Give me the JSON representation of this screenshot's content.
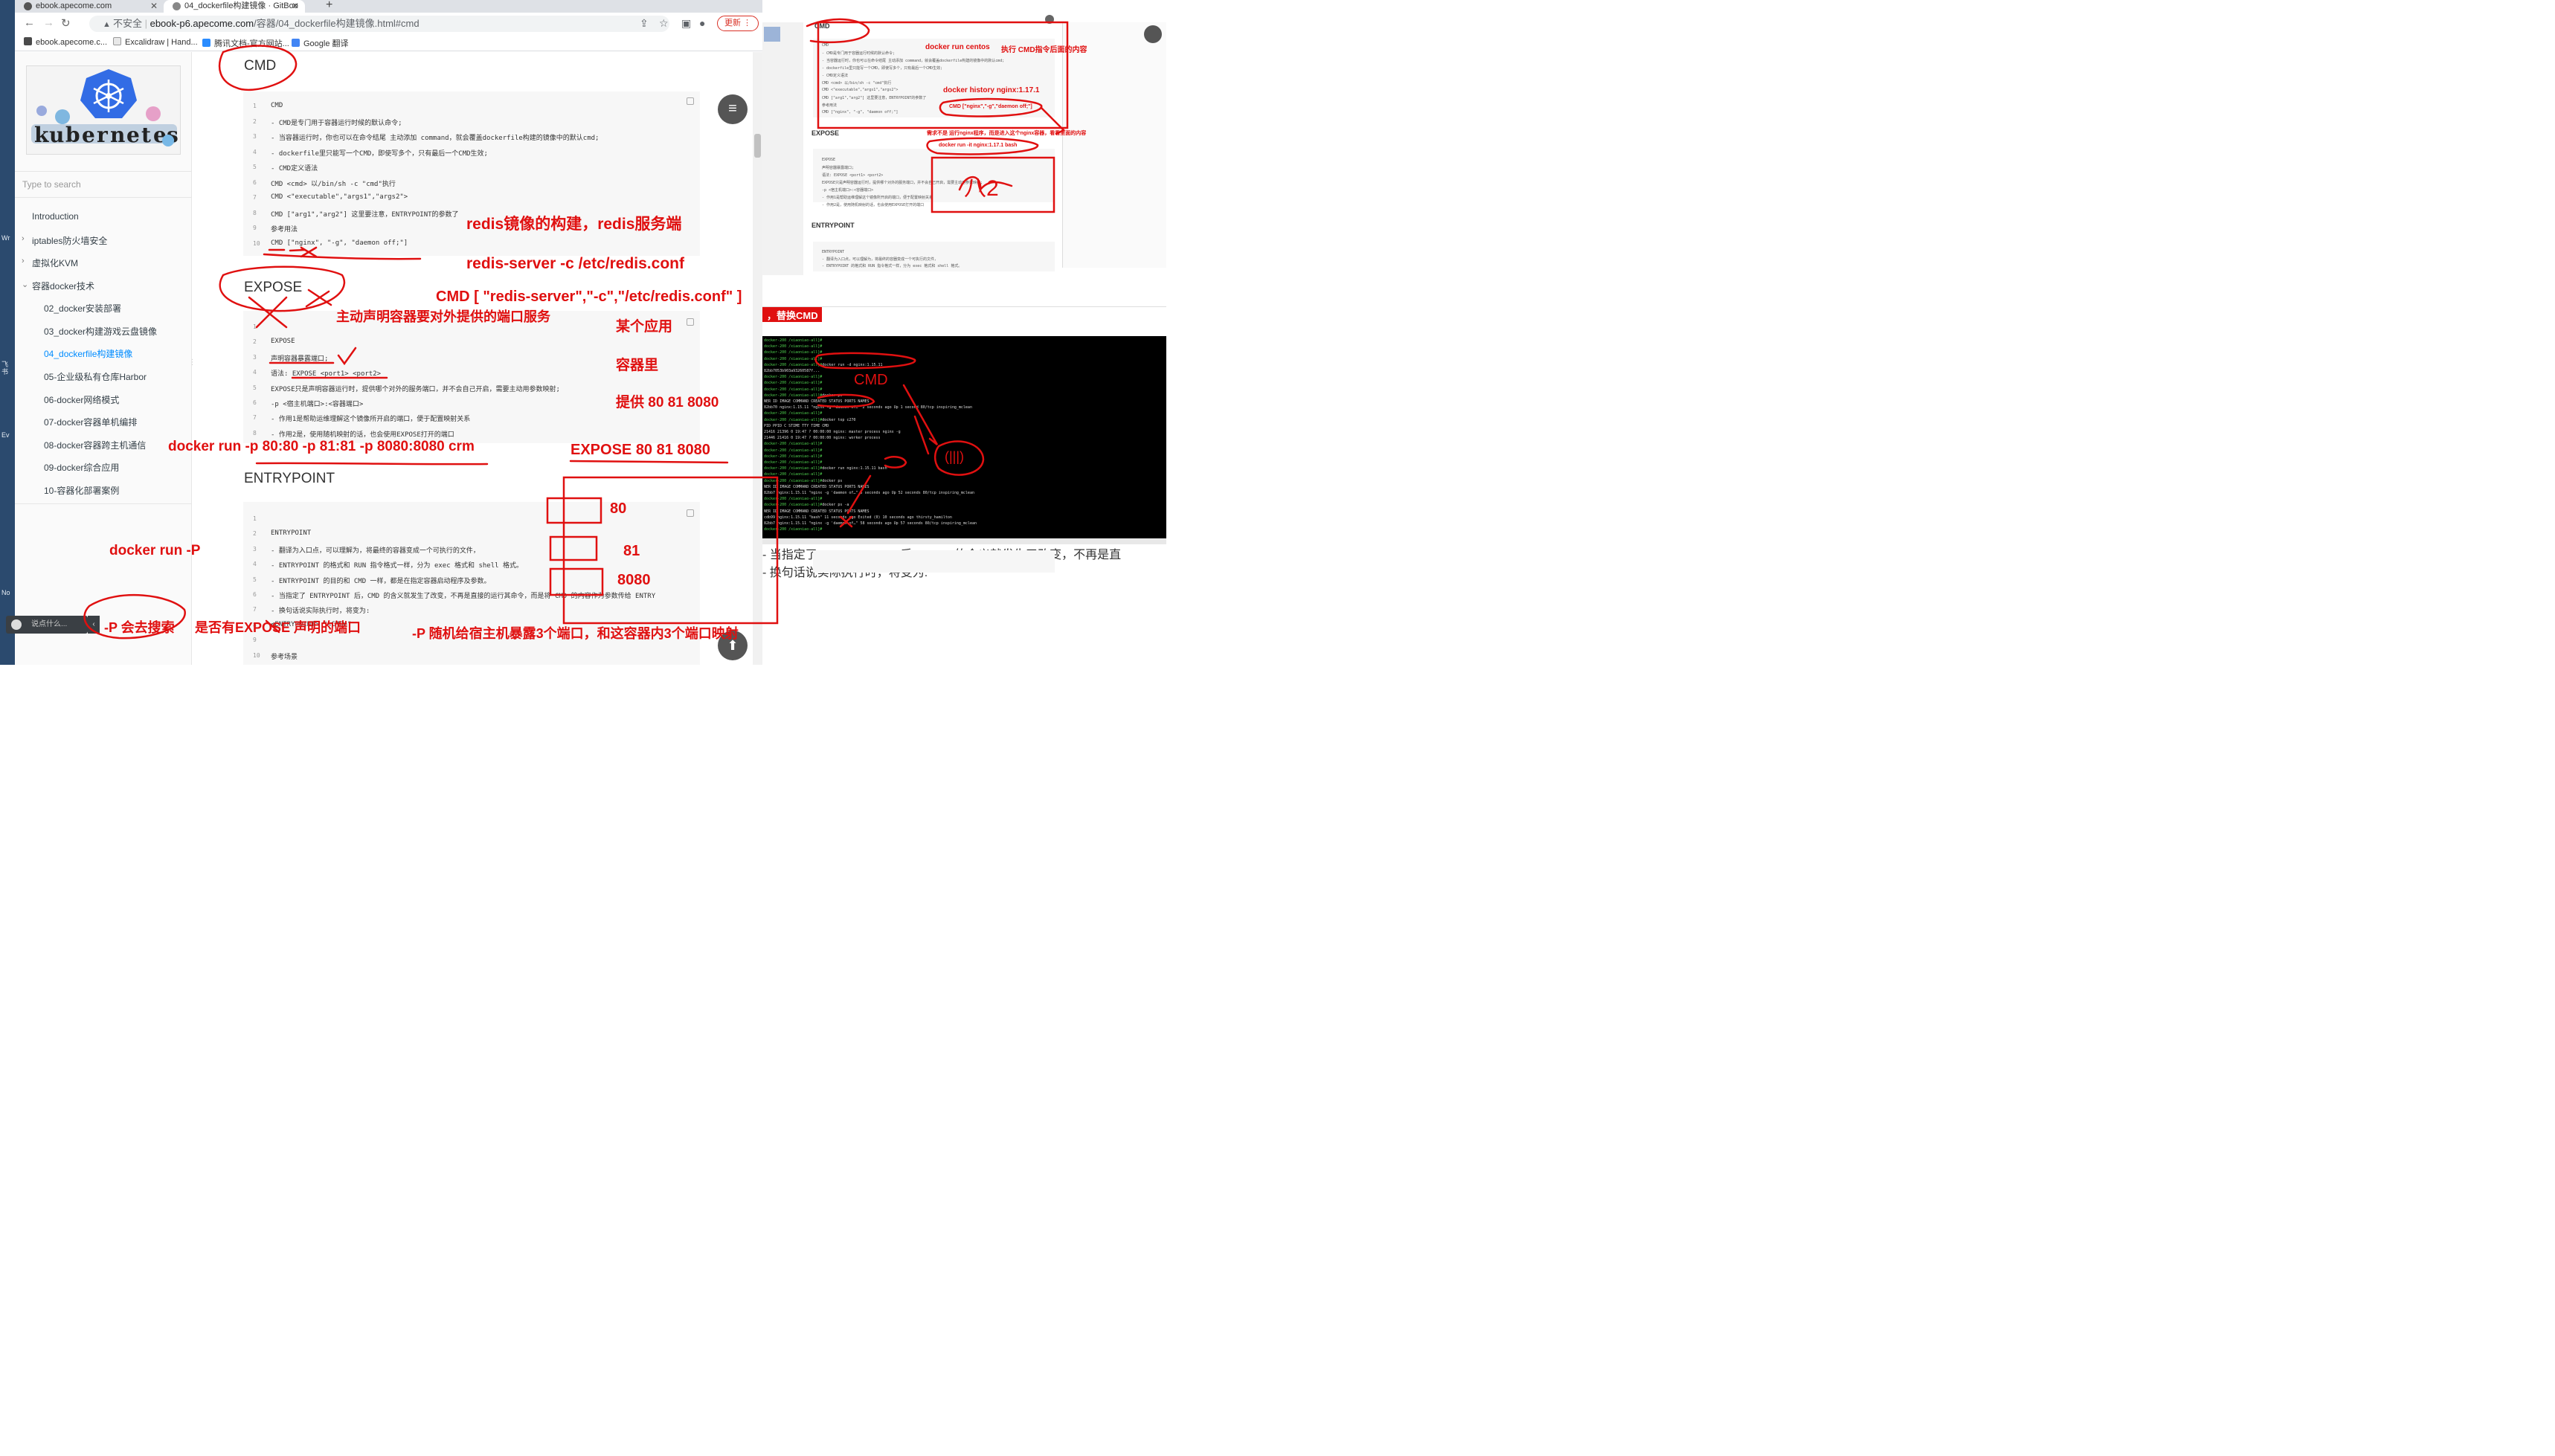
{
  "desktop": {
    "labels": [
      "Wr",
      "飞书",
      "Ev",
      "No"
    ]
  },
  "browser": {
    "tabs": [
      {
        "title": "ebook.apecome.com"
      },
      {
        "title": "04_dockerfile构建镜像 · GitBoo"
      }
    ],
    "new_tab": "+",
    "url_warning": "不安全",
    "url_domain": "ebook-p6.apecome.com",
    "url_path": "/容器/04_dockerfile构建镜像.html#cmd",
    "update_label": "更新",
    "bookmarks": [
      "ebook.apecome.c...",
      "Excalidraw | Hand...",
      "腾讯文档-官方网站...",
      "Google 翻译"
    ]
  },
  "sidebar": {
    "search_placeholder": "Type to search",
    "items": [
      {
        "label": "Introduction"
      },
      {
        "label": "iptables防火墙安全"
      },
      {
        "label": "虚拟化KVM"
      },
      {
        "label": "容器docker技术"
      },
      {
        "label": "02_docker安装部署"
      },
      {
        "label": "03_docker构建游戏云盘镜像"
      },
      {
        "label": "04_dockerfile构建镜像"
      },
      {
        "label": "05-企业级私有仓库Harbor"
      },
      {
        "label": "06-docker网络模式"
      },
      {
        "label": "07-docker容器单机编排"
      },
      {
        "label": "08-docker容器跨主机通信"
      },
      {
        "label": "09-docker综合应用"
      },
      {
        "label": "10-容器化部署案例"
      }
    ],
    "chat_placeholder": "说点什么..."
  },
  "content": {
    "h_cmd": "CMD",
    "cmd_lines": [
      "CMD",
      "- CMD是专门用于容器运行时候的默认命令;",
      "- 当容器运行时，你也可以在命令结尾 主动添加 command，就会覆盖dockerfile构建的镜像中的默认cmd;",
      "- dockerfile里只能写一个CMD，即使写多个，只有最后一个CMD生效;",
      "- CMD定义语法",
      "CMD <cmd>  以/bin/sh -c \"cmd\"执行",
      "CMD <\"executable\",\"args1\",\"args2\">",
      "CMD [\"arg1\",\"arg2\"]    这里要注意，ENTRYPOINT的参数了",
      "参考用法",
      "CMD [\"nginx\", \"-g\", \"daemon off;\"]"
    ],
    "h_expose": "EXPOSE",
    "expose_lines": [
      "",
      "EXPOSE",
      "声明容器暴露端口;",
      "语法: EXPOSE <port1> <port2>",
      "EXPOSE只是声明容器运行时，提供哪个对外的服务端口，并不会自己开启，需要主动用参数映射;",
      "-p <宿主机端口>:<容器端口>",
      "- 作用1是帮助运维理解这个镜像所开启的端口，便于配置映射关系",
      "- 作用2是，使用随机映射的话，也会使用EXPOSE打开的端口"
    ],
    "h_entrypoint": "ENTRYPOINT",
    "entry_lines": [
      "",
      "ENTRYPOINT",
      "- 翻译为入口点，可以理解为，将最终的容器变成一个可执行的文件，",
      "- ENTRYPOINT 的格式和 RUN 指令格式一样，分为 exec 格式和 shell 格式。",
      "- ENTRYPOINT 的目的和 CMD 一样，都是在指定容器启动程序及参数。",
      "- 当指定了 ENTRYPOINT 后，CMD 的含义就发生了改变，不再是直接的运行其命令，而是将 CMD 的内容作为参数传给 ENTRY",
      "- 换句话说实际执行时，将变为:",
      "<ENTRYPOINT> \"<CMD>\"",
      "",
      "参考场景"
    ],
    "menu_icon": "≡",
    "up_icon": "⬆"
  },
  "right_panel": {
    "h_cmd": "CMD",
    "h_expose": "EXPOSE",
    "h_entrypoint": "ENTRYPOINT",
    "replace_cmd": "，替换CMD",
    "mini_cmd": [
      "CMD",
      "- CMD是专门用于容器运行时候的默认命令;",
      "- 当容器运行时，你也可以在命令结尾 主动添加 command，就会覆盖dockerfile构建的镜像中的默认cmd;",
      "- dockerfile里只能写一个CMD，即使写多个，只有最后一个CMD生效;",
      "- CMD定义语法",
      "CMD <cmd>  以/bin/sh -c \"cmd\"执行",
      "CMD <\"executable\",\"args1\",\"args2\">",
      "CMD [\"arg1\",\"arg2\"]   这里要注意，ENTRYPOINT的参数了",
      "参考用法",
      "CMD [\"nginx\", \"-g\", \"daemon off;\"]"
    ],
    "mini_expose": [
      "EXPOSE",
      "声明容器暴露端口;",
      "语法: EXPOSE <port1> <port2>",
      "EXPOSE只是声明容器运行时，提供哪个对外的服务端口，并不会自己开启，需要主动用参数映射;",
      "-p <宿主机端口>:<容器端口>",
      "- 作用1是帮助运维理解这个镜像所开启的端口，便于配置映射关系",
      "- 作用2是，使用随机映射的话，也会使用EXPOSE打开的端口"
    ],
    "mini_entry": [
      "ENTRYPOINT",
      "- 翻译为入口点，可以理解为，将最终的容器变成一个可执行的文件，",
      "- ENTRYPOINT 的格式和 RUN 指令格式一样，分为 exec 格式和 shell 格式。"
    ],
    "mini_bottom": [
      "- 当指定了 ENTRYPOINT 后，CMD 的含义就发生了改变，不再是直",
      "- 换句话说实际执行时，将变为:"
    ],
    "terminal_lines": [
      "docker-200 /xiaoniao-all]#",
      "docker-200 /xiaoniao-all]#",
      "docker-200 /xiaoniao-all]#",
      "docker-200 /xiaoniao-all]#",
      "docker-200 /xiaoniao-all]#docker run -d  nginx:1.15.11",
      "82bb7053b903a93260587f...",
      "docker-200 /xiaoniao-all]#",
      "docker-200 /xiaoniao-all]#",
      "docker-200 /xiaoniao-all]#",
      "docker-200 /xiaoniao-all]#docker ps",
      "NER ID   IMAGE          COMMAND                  CREATED          STATUS          PORTS    NAMES",
      "82bb70   nginx:1.15.11  \"nginx -g 'daemon of…\"  2 seconds ago    Up 1 second     80/tcp   inspiring_mclean",
      "docker-200 /xiaoniao-all]#",
      "docker-200 /xiaoniao-all]#docker  top c270",
      "          PID        PPID       C       STIME     TTY       TIME       CMD",
      "          21416      21396      0       19:47     ?         00:00:00   nginx: master process nginx -g",
      "          21446      21416      0       19:47     ?         00:00:00   nginx: worker process",
      "docker-200 /xiaoniao-all]#",
      "docker-200 /xiaoniao-all]#",
      "docker-200 /xiaoniao-all]#",
      "docker-200 /xiaoniao-all]#",
      "docker-200 /xiaoniao-all]#docker run nginx:1.15.11 bash",
      "docker-200 /xiaoniao-all]#",
      "docker-200 /xiaoniao-all]#docker ps",
      "NER ID   IMAGE          COMMAND                  CREATED          STATUS          PORTS    NAMES",
      "82bb7    nginx:1.15.11  \"nginx -g 'daemon of…\"  5 seconds ago    Up 52 seconds   80/tcp   inspiring_mclean",
      "docker-200 /xiaoniao-all]#",
      "docker-200 /xiaoniao-all]#docker ps -a",
      "NER ID   IMAGE          COMMAND                  CREATED          STATUS                       PORTS    NAMES",
      "cdb99    nginx:1.15.11  \"bash\"                   11 seconds ago   Exited (0) 10 seconds ago             thirsty_hamilton",
      "82bb7    nginx:1.15.11  \"nginx -g 'daemon of…\"  58 seconds ago   Up 57 seconds                80/tcp   inspiring_mclean",
      "docker-200 /xiaoniao-all]#"
    ]
  },
  "annotations": {
    "redis_build": "redis镜像的构建，redis服务端",
    "redis_server": "redis-server   -c  /etc/redis.conf",
    "cmd_redis": "CMD  [ \"redis-server\",\"-c\",\"/etc/redis.conf\"  ]",
    "expose_desc": "主动声明容器要对外提供的端口服务",
    "some_app": "某个应用",
    "in_container": "容器里",
    "provide_ports": "提供 80 81 8080",
    "docker_run_p": "docker run   -p 80:80 -p 81:81 -p 8080:8080   crm",
    "expose_ports": "EXPOSE  80 81  8080",
    "port_80": "80",
    "port_81": "81",
    "port_8080": "8080",
    "docker_run_P": "docker run -P",
    "p_search": "-P 会去搜索",
    "p_search_tail": "是否有EXPOSE 声明的端口",
    "p_random": "-P  随机给宿主机暴露3个端口，和这容器内3个端口映射",
    "r_docker_run_centos": "docker run  centos",
    "r_exec_cmd": "执行 CMD指令后面的内容",
    "r_docker_history": "docker history  nginx:1.17.1",
    "r_cmd_nginx": "CMD [\"nginx\",\"-g\",\"daemon off;\"]",
    "r_need_run": "需求不是 运行nginx程序，而是进入这个nginx容器，看看里面的内容",
    "r_docker_run_bash": "docker run  -it  nginx:1.17.1   bash",
    "r_scribble": "八2",
    "t_cmd": "CMD",
    "t_circle": "(|||)"
  },
  "colors": {
    "annotation": "#e01010",
    "link": "#008cff",
    "terminal_bg": "#000000"
  }
}
